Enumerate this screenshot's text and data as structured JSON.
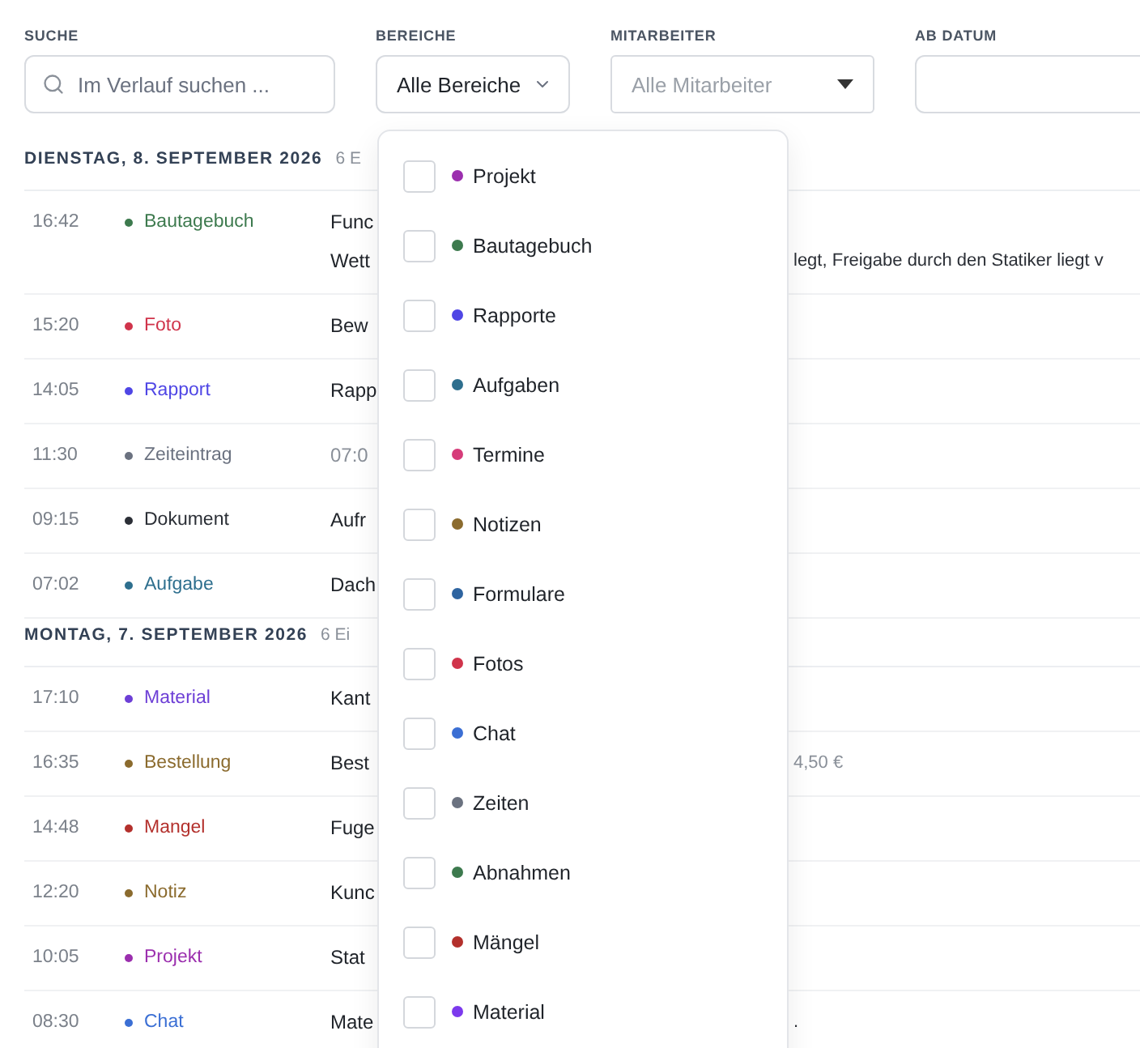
{
  "filters": {
    "search": {
      "label": "SUCHE",
      "placeholder": "Im Verlauf suchen ..."
    },
    "areas": {
      "label": "BEREICHE",
      "value": "Alle Bereiche"
    },
    "staff": {
      "label": "MITARBEITER",
      "placeholder": "Alle Mitarbeiter"
    },
    "date": {
      "label": "AB DATUM"
    }
  },
  "days": [
    {
      "heading": "DIENSTAG, 8. SEPTEMBER 2026",
      "count": "6 E",
      "entries": [
        {
          "time": "16:42",
          "category": "Bautagebuch",
          "color": "#3d7a4e",
          "title": "Func",
          "muted": false,
          "subtitle": "Wett",
          "tail": "legt, Freigabe durch den Statiker liegt v",
          "tail_muted": false
        },
        {
          "time": "15:20",
          "category": "Foto",
          "color": "#d0344b",
          "title": "Bew",
          "muted": false
        },
        {
          "time": "14:05",
          "category": "Rapport",
          "color": "#4f46e5",
          "title": "Rapp",
          "muted": false
        },
        {
          "time": "11:30",
          "category": "Zeiteintrag",
          "color": "#6b7280",
          "title": "07:0",
          "muted": true
        },
        {
          "time": "09:15",
          "category": "Dokument",
          "color": "#2b2f36",
          "title": "Aufr",
          "muted": false
        },
        {
          "time": "07:02",
          "category": "Aufgabe",
          "color": "#2e6f8e",
          "title": "Dach",
          "muted": false
        }
      ]
    },
    {
      "heading": "MONTAG, 7. SEPTEMBER 2026",
      "count": "6 Ei",
      "entries": [
        {
          "time": "17:10",
          "category": "Material",
          "color": "#6d3fd6",
          "title": "Kant",
          "muted": false
        },
        {
          "time": "16:35",
          "category": "Bestellung",
          "color": "#8b6b2e",
          "title": "Best",
          "muted": false,
          "tail": "4,50 €",
          "tail_muted": true
        },
        {
          "time": "14:48",
          "category": "Mangel",
          "color": "#b3302c",
          "title": "Fuge",
          "muted": false
        },
        {
          "time": "12:20",
          "category": "Notiz",
          "color": "#8b6b2e",
          "title": "Kunc",
          "muted": false
        },
        {
          "time": "10:05",
          "category": "Projekt",
          "color": "#9b2fae",
          "title": "Stat",
          "muted": false
        },
        {
          "time": "08:30",
          "category": "Chat",
          "color": "#3b6fd4",
          "title": "Mate",
          "muted": false,
          "tail": ".",
          "tail_muted": false
        }
      ]
    }
  ],
  "dropdown": {
    "options": [
      {
        "label": "Projekt",
        "color": "#9b2fae",
        "checked": false
      },
      {
        "label": "Bautagebuch",
        "color": "#3d7a4e",
        "checked": false
      },
      {
        "label": "Rapporte",
        "color": "#4f46e5",
        "checked": false
      },
      {
        "label": "Aufgaben",
        "color": "#2e6f8e",
        "checked": false
      },
      {
        "label": "Termine",
        "color": "#d63c7a",
        "checked": false
      },
      {
        "label": "Notizen",
        "color": "#8b6b2e",
        "checked": false
      },
      {
        "label": "Formulare",
        "color": "#2e64a0",
        "checked": false
      },
      {
        "label": "Fotos",
        "color": "#d0344b",
        "checked": false
      },
      {
        "label": "Chat",
        "color": "#3b6fd4",
        "checked": false
      },
      {
        "label": "Zeiten",
        "color": "#6b7280",
        "checked": false
      },
      {
        "label": "Abnahmen",
        "color": "#3d7a4e",
        "checked": false
      },
      {
        "label": "Mängel",
        "color": "#b3302c",
        "checked": false
      },
      {
        "label": "Material",
        "color": "#7c3aed",
        "checked": false
      }
    ]
  }
}
